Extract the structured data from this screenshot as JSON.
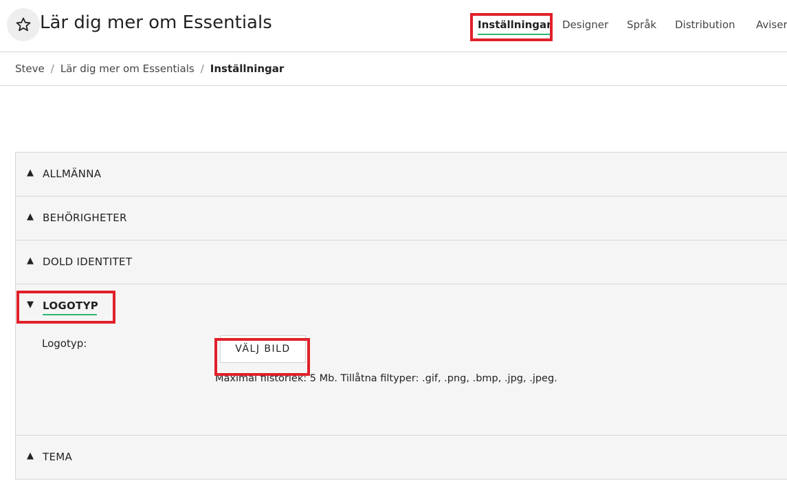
{
  "header": {
    "title": "Lär dig mer om Essentials",
    "star_icon": "star-outline-icon",
    "nav": [
      {
        "label": "Inställningar",
        "active": true
      },
      {
        "label": "Designer",
        "active": false
      },
      {
        "label": "Språk",
        "active": false
      },
      {
        "label": "Distribution",
        "active": false
      },
      {
        "label": "Aviser",
        "active": false
      }
    ]
  },
  "breadcrumb": {
    "items": [
      "Steve",
      "Lär dig mer om Essentials",
      "Inställningar"
    ],
    "separator": "/"
  },
  "sections": [
    {
      "label": "ALLMÄNNA",
      "expanded": false,
      "arrow": "▲"
    },
    {
      "label": "BEHÖRIGHETER",
      "expanded": false,
      "arrow": "▲"
    },
    {
      "label": "DOLD IDENTITET",
      "expanded": false,
      "arrow": "▲"
    },
    {
      "label": "LOGOTYP",
      "expanded": true,
      "arrow": "▼"
    },
    {
      "label": "TEMA",
      "expanded": false,
      "arrow": "▲"
    }
  ],
  "logotyp": {
    "field_label": "Logotyp:",
    "button_label": "VÄLJ BILD",
    "help_text": "Maximal filstorlek: 5 Mb. Tillåtna filtyper: .gif, .png, .bmp, .jpg, .jpeg."
  },
  "colors": {
    "accent_underline": "#2bb673",
    "highlight_box": "#e0202a",
    "section_background": "#f5f5f5"
  }
}
